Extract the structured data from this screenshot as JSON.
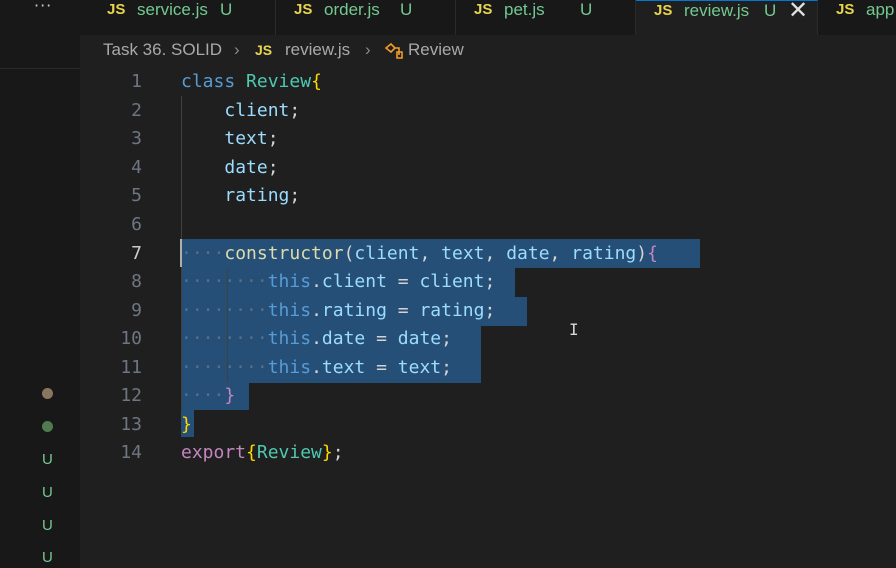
{
  "side": {
    "more_label": "···",
    "status_marks": [
      "U",
      "U",
      "U",
      "U"
    ],
    "dot_colors": [
      "#8a7660",
      "#4f7a52"
    ]
  },
  "tabs": [
    {
      "icon": "JS",
      "name": "service.js",
      "status": "U",
      "active": false
    },
    {
      "icon": "JS",
      "name": "order.js",
      "status": "U",
      "active": false
    },
    {
      "icon": "JS",
      "name": "pet.js",
      "status": "U",
      "active": false
    },
    {
      "icon": "JS",
      "name": "review.js",
      "status": "U",
      "active": true,
      "close": "✕"
    },
    {
      "icon": "JS",
      "name": "app",
      "status": "",
      "active": false
    }
  ],
  "breadcrumb": {
    "folder": "Task 36. SOLID",
    "sep": "›",
    "file_icon": "JS",
    "file": "review.js",
    "symbol": "Review"
  },
  "editor": {
    "line_numbers": [
      "1",
      "2",
      "3",
      "4",
      "5",
      "6",
      "7",
      "8",
      "9",
      "10",
      "11",
      "12",
      "13",
      "14"
    ],
    "current_line": 7,
    "lines": [
      {
        "kw": "class ",
        "cls": "Review",
        "brace": "{"
      },
      {
        "prop": "client",
        "punc": ";"
      },
      {
        "prop": "text",
        "punc": ";"
      },
      {
        "prop": "date",
        "punc": ";"
      },
      {
        "prop": "rating",
        "punc": ";"
      },
      {},
      {
        "fn": "constructor",
        "p1": "(",
        "a1": "client",
        "c1": ", ",
        "a2": "text",
        "c2": ", ",
        "a3": "date",
        "c3": ", ",
        "a4": "rating",
        "p2": ")",
        "brace": "{"
      },
      {
        "this": "this",
        "dot": ".",
        "prop": "client",
        "eq": " = ",
        "val": "client",
        "semi": ";"
      },
      {
        "this": "this",
        "dot": ".",
        "prop": "rating",
        "eq": " = ",
        "val": "rating",
        "semi": ";"
      },
      {
        "this": "this",
        "dot": ".",
        "prop": "date",
        "eq": " = ",
        "val": "date",
        "semi": ";"
      },
      {
        "this": "this",
        "dot": ".",
        "prop": "text",
        "eq": " = ",
        "val": "text",
        "semi": ";"
      },
      {
        "brace": "}"
      },
      {
        "brace": "}"
      },
      {
        "kw": "export",
        "b1": "{",
        "cls": "Review",
        "b2": "}",
        "semi": ";"
      }
    ],
    "ibeam": "I"
  }
}
